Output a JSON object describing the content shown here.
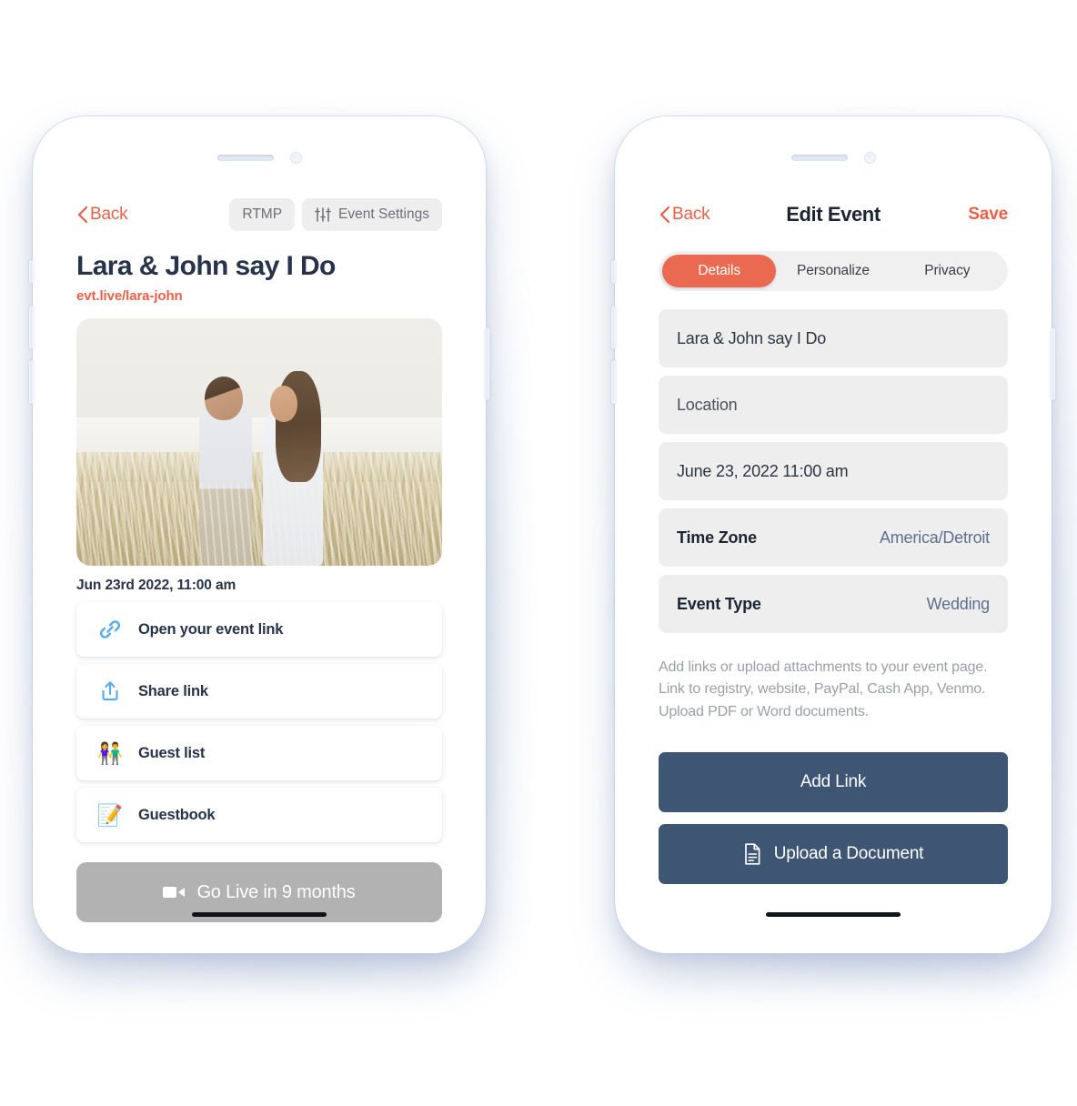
{
  "colors": {
    "accent_coral": "#EC5F48",
    "segment_active": "#E96A50",
    "button_slate": "#3E5574",
    "golive_gray": "#B2B2B2",
    "link_blue": "#5BAEEA",
    "field_gray": "#EEEEEF",
    "text_dark": "#26334A"
  },
  "left_phone": {
    "topbar": {
      "back_label": "Back",
      "back_icon": "chevron-left-icon",
      "rtmp_label": "RTMP",
      "event_settings_label": "Event Settings",
      "event_settings_icon": "sliders-icon"
    },
    "event_title": "Lara & John say I Do",
    "event_url": "evt.live/lara-john",
    "photo_alt": "Couple embracing in a wheat field",
    "date_line": "Jun 23rd 2022, 11:00 am",
    "actions": [
      {
        "label": "Open your event link",
        "icon": "link-chain-icon"
      },
      {
        "label": "Share link",
        "icon": "share-upload-icon"
      },
      {
        "label": "Guest list",
        "icon": "people-icon",
        "emoji": "👫"
      },
      {
        "label": "Guestbook",
        "icon": "memo-icon",
        "emoji": "📝"
      }
    ],
    "go_live": {
      "label": "Go Live in 9 months",
      "icon": "video-camera-icon",
      "state": "disabled"
    }
  },
  "right_phone": {
    "topbar": {
      "back_label": "Back",
      "back_icon": "chevron-left-icon",
      "title": "Edit Event",
      "save_label": "Save"
    },
    "tabs": [
      {
        "label": "Details",
        "active": true
      },
      {
        "label": "Personalize",
        "active": false
      },
      {
        "label": "Privacy",
        "active": false
      }
    ],
    "fields": [
      {
        "type": "text",
        "value": "Lara & John say I Do"
      },
      {
        "type": "placeholder",
        "value": "Location"
      },
      {
        "type": "text",
        "value": "June 23, 2022 11:00 am"
      },
      {
        "type": "row",
        "label": "Time Zone",
        "value": "America/Detroit"
      },
      {
        "type": "row",
        "label": "Event Type",
        "value": "Wedding"
      }
    ],
    "helper_text": "Add links or upload attachments to your event page. Link to registry, website, PayPal, Cash App, Venmo. Upload PDF or Word documents.",
    "buttons": [
      {
        "label": "Add Link",
        "icon": null
      },
      {
        "label": "Upload a Document",
        "icon": "document-icon"
      }
    ]
  }
}
